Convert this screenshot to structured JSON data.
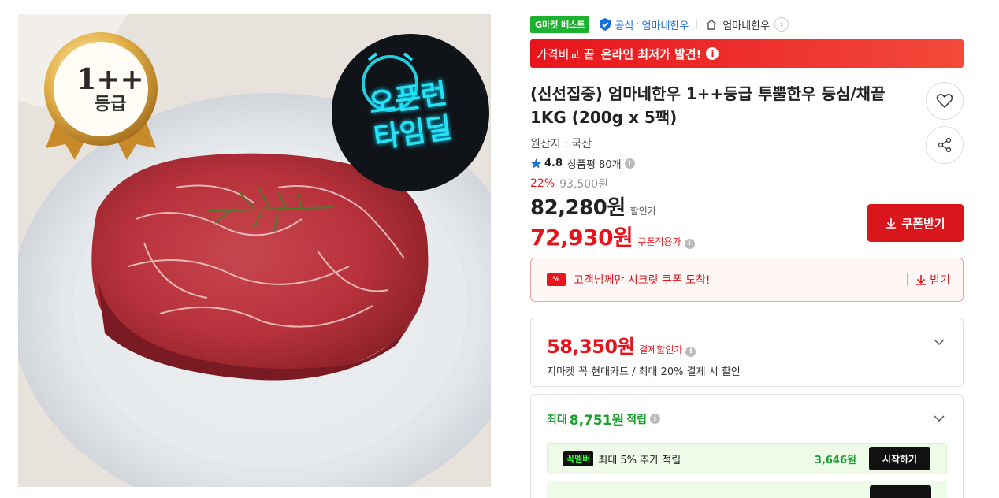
{
  "image": {
    "grade_badge": {
      "line1": "1++",
      "line2": "등급"
    },
    "timedeal_badge": {
      "line1": "오픈런",
      "line2": "타임딜"
    }
  },
  "header": {
    "best_badge": "G마켓 베스트",
    "official_label": "공식",
    "official_seller": "엄마네한우",
    "store_name": "엄마네한우"
  },
  "compare_banner": {
    "text": "가격비교 끝",
    "strong": "온라인 최저가 발견!"
  },
  "product": {
    "title": "(신선집중) 엄마네한우 1++등급 투뿔한우 등심/채끝 1KG (200g x 5팩)",
    "origin": "원산지 : 국산",
    "rating": "4.8",
    "review_link": "상품평 80개",
    "discount_rate": "22%",
    "original_price": "93,500원",
    "sale_price": "82,280원",
    "sale_label": "할인가",
    "coupon_price": "72,930원",
    "coupon_label": "쿠폰적용가",
    "coupon_button": "쿠폰받기"
  },
  "secret_coupon": {
    "text": "고객님께만 시크릿 쿠폰 도착!",
    "action": "받기"
  },
  "card_payment": {
    "price": "58,350원",
    "label": "결제할인가",
    "description": "지마켓 꼭 현대카드 / 최대 20% 결제 시 할인"
  },
  "points": {
    "prefix": "최대",
    "amount": "8,751원",
    "suffix": "적립",
    "member_badge": "꼭멤버",
    "member_text": "최대 5% 추가 적립",
    "member_points": "3,646원",
    "start_button": "시작하기"
  },
  "colors": {
    "accent_red": "#e8141b",
    "best_green": "#1bb32d",
    "official_blue": "#1a6fd6",
    "points_green": "#16a02b"
  }
}
